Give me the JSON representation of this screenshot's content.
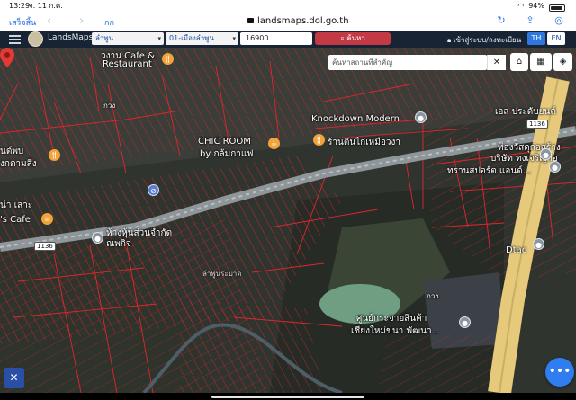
{
  "status": {
    "time": "13:29",
    "date": "จ. 11 ก.ค.",
    "battery_pct": 0.94,
    "battery_label": "94%"
  },
  "browser": {
    "done_label": "เสร็จสิ้น",
    "text_size_label": "กก",
    "url": "landsmaps.dol.go.th"
  },
  "app": {
    "brand": "LandsMaps",
    "province": "ลำพูน",
    "district": "01-เมืองลำพูน",
    "parcel_number": "16900",
    "search_label": "ค้นหา",
    "login_label": "เข้าสู่ระบบ/ลงทะเบียน",
    "lang_th": "TH",
    "lang_en": "EN"
  },
  "map": {
    "place_search_placeholder": "ค้นหาสถานที่สำคัญ",
    "close_glyph": "✕",
    "labels": {
      "restaurant_top": "Restaurant",
      "cafe_top": "วงาน Cafe &",
      "knockdown": "Knockdown Modern",
      "chic_room": "CHIC ROOM",
      "chic_room_sub": "by กล้มกาแฟ",
      "shop_thai": "ร้านตินไก่เหมือวงา",
      "es_top": "เอส ประดับยนต์",
      "tong": "ท่องวัสดุก่อสร้าง",
      "bjp": "บริษัท ทงเจริญก่อ",
      "transport": "ทรานสปอร์ต แอนด์...",
      "left1": "นต์พบ",
      "left2": "งกตามสิ่ง",
      "left3": "น่า เลาะ",
      "left4": "'s Cafe",
      "shop_left": "ห้างหุ้นส่วนจำกัด",
      "shop_left2": "ณพกิจ",
      "pin_label": "ลำพูนระบาด",
      "dtac": "Dtac",
      "center": "ศูนย์กระจายสินค้า",
      "center2": "เชียงใหม่ขนา พัฒนา...",
      "road_1136a": "1136",
      "road_1136b": "1136",
      "khwang": "กวง",
      "khwang2": "กวง"
    }
  },
  "colors": {
    "parcel_line": "#e0262d",
    "header_bg": "#182333",
    "search_red": "#c43a44",
    "select_text": "#1a4d9e",
    "fab_blue": "#2f7df0",
    "highway": "#e6c97a"
  }
}
